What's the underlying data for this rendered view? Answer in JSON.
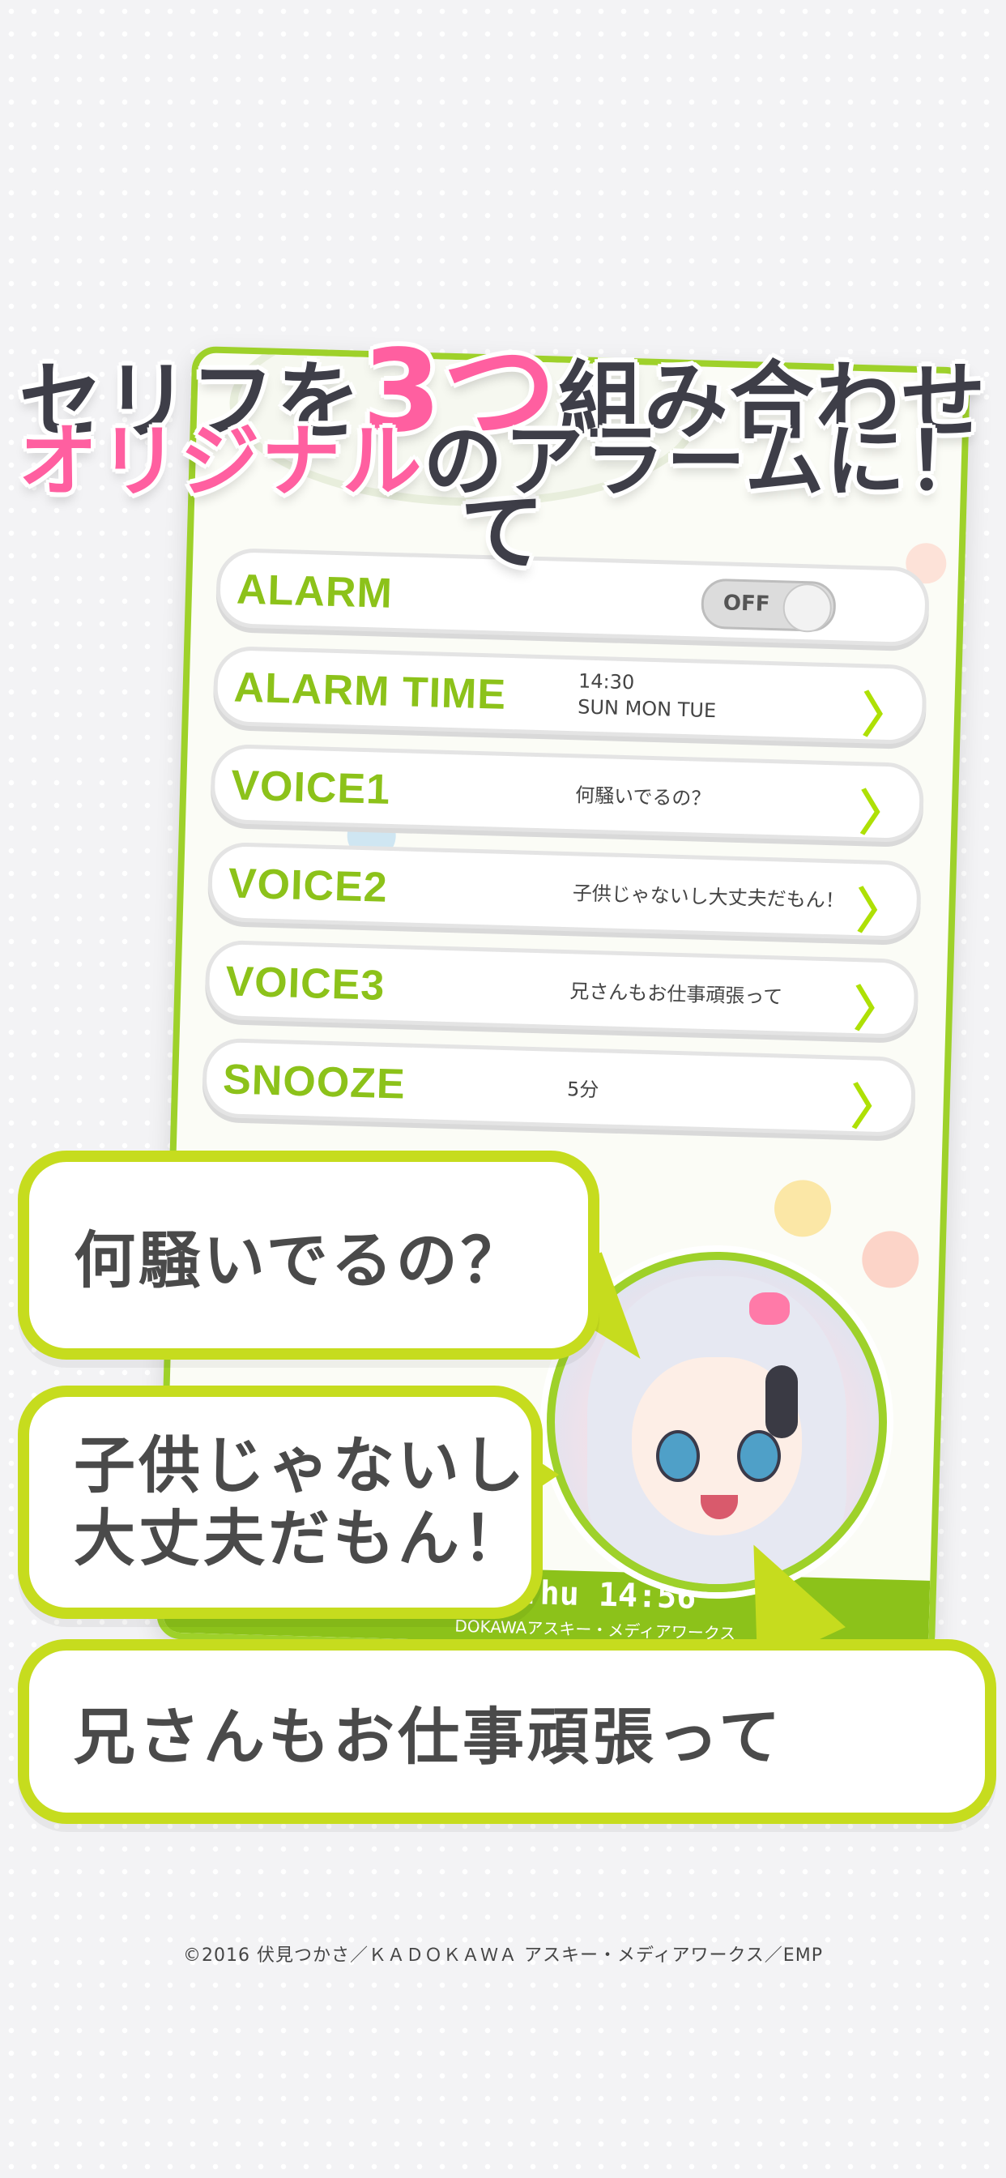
{
  "headline": {
    "line1_a": "セリフを",
    "line1_b": "3つ",
    "line1_c": "組み合わせて",
    "line2_a": "オリジナル",
    "line2_b": "のアラームに！"
  },
  "settings": {
    "rows": [
      {
        "label": "ALARM",
        "toggle_state": "OFF"
      },
      {
        "label": "ALARM TIME",
        "value_time": "14:30",
        "value_days": "SUN MON TUE"
      },
      {
        "label": "VOICE1",
        "value": "何騒いでるの？"
      },
      {
        "label": "VOICE2",
        "value": "子供じゃないし大丈夫だもん！"
      },
      {
        "label": "VOICE3",
        "value": "兄さんもお仕事頑張って"
      },
      {
        "label": "SNOOZE",
        "value": "5分"
      }
    ],
    "chevron": "〉"
  },
  "phone_footer": {
    "time": "Thu 14:56",
    "credit": "DOKAWAアスキー・メディアワークス"
  },
  "bubbles": {
    "b1": "何騒いでるの？",
    "b2_line1": "子供じゃないし",
    "b2_line2": "大丈夫だもん！",
    "b3": "兄さんもお仕事頑張って"
  },
  "copyright": "©2016 伏見つかさ／ＫＡＤＯＫＡＷＡ アスキー・メディアワークス／EMP",
  "colors": {
    "accent_green": "#8cc21a",
    "bubble_border": "#c6dc1e",
    "headline_pink": "#ff5fa0",
    "headline_dark": "#3e3e48"
  }
}
